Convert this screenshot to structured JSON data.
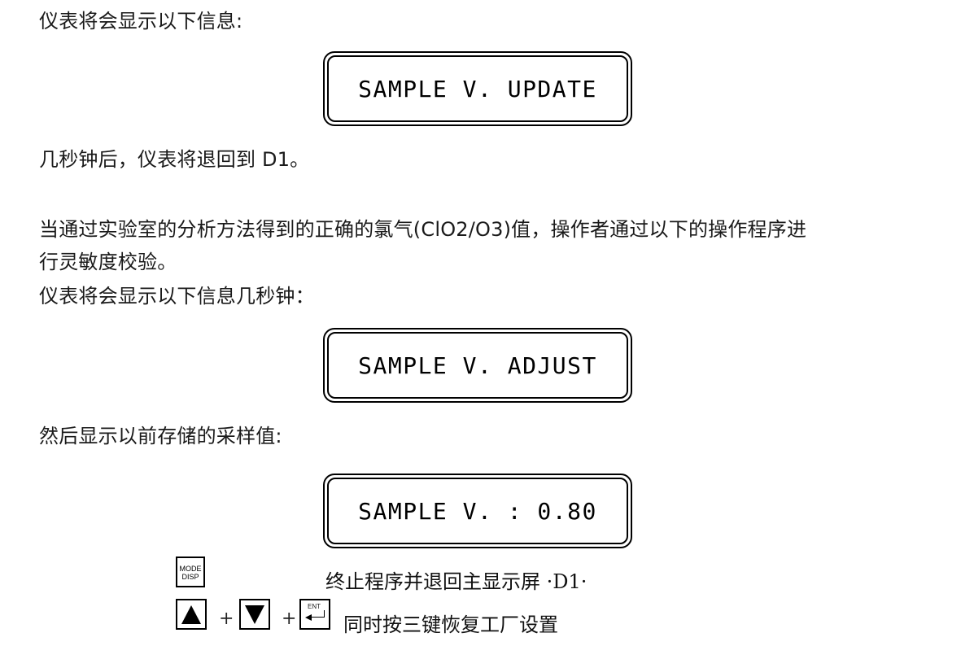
{
  "paragraphs": {
    "p1": "仪表将会显示以下信息:",
    "p2": "几秒钟后，仪表将退回到 D1。",
    "p3_line1": "当通过实验室的分析方法得到的正确的氯气(ClO2/O3)值，操作者通过以下的操作程序进",
    "p3_line2": "行灵敏度校验。",
    "p4": "仪表将会显示以下信息几秒钟：",
    "p5": "然后显示以前存储的采样值:"
  },
  "displays": [
    {
      "text": "SAMPLE V. UPDATE"
    },
    {
      "text": "SAMPLE V. ADJUST"
    },
    {
      "text": "SAMPLE V. : 0.80"
    }
  ],
  "keys": {
    "mode_line1": "MODE",
    "mode_line2": "DISP",
    "ent_label": "ENT",
    "plus": "+",
    "mode_desc": "终止程序并退回主显示屏 ·D1·",
    "combo_desc": "同时按三键恢复工厂设置"
  }
}
